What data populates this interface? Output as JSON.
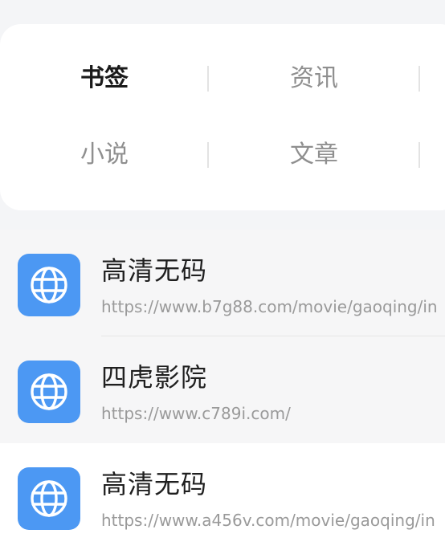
{
  "tabs": [
    {
      "label": "书签",
      "active": true
    },
    {
      "label": "资讯",
      "active": false
    },
    {
      "label": "小说",
      "active": false
    },
    {
      "label": "文章",
      "active": false
    }
  ],
  "bookmarks": [
    {
      "title": "高清无码",
      "url": "https://www.b7g88.com/movie/gaoqing/in",
      "icon": "globe-icon"
    },
    {
      "title": "四虎影院",
      "url": "https://www.c789i.com/",
      "icon": "globe-icon"
    },
    {
      "title": "高清无码",
      "url": "https://www.a456v.com/movie/gaoqing/in",
      "icon": "globe-icon"
    }
  ],
  "colors": {
    "icon_bg": "#4c98f3",
    "active_tab": "#1a1a1a",
    "inactive_tab": "#8f8f8f",
    "url_text": "#9a9a9a"
  }
}
